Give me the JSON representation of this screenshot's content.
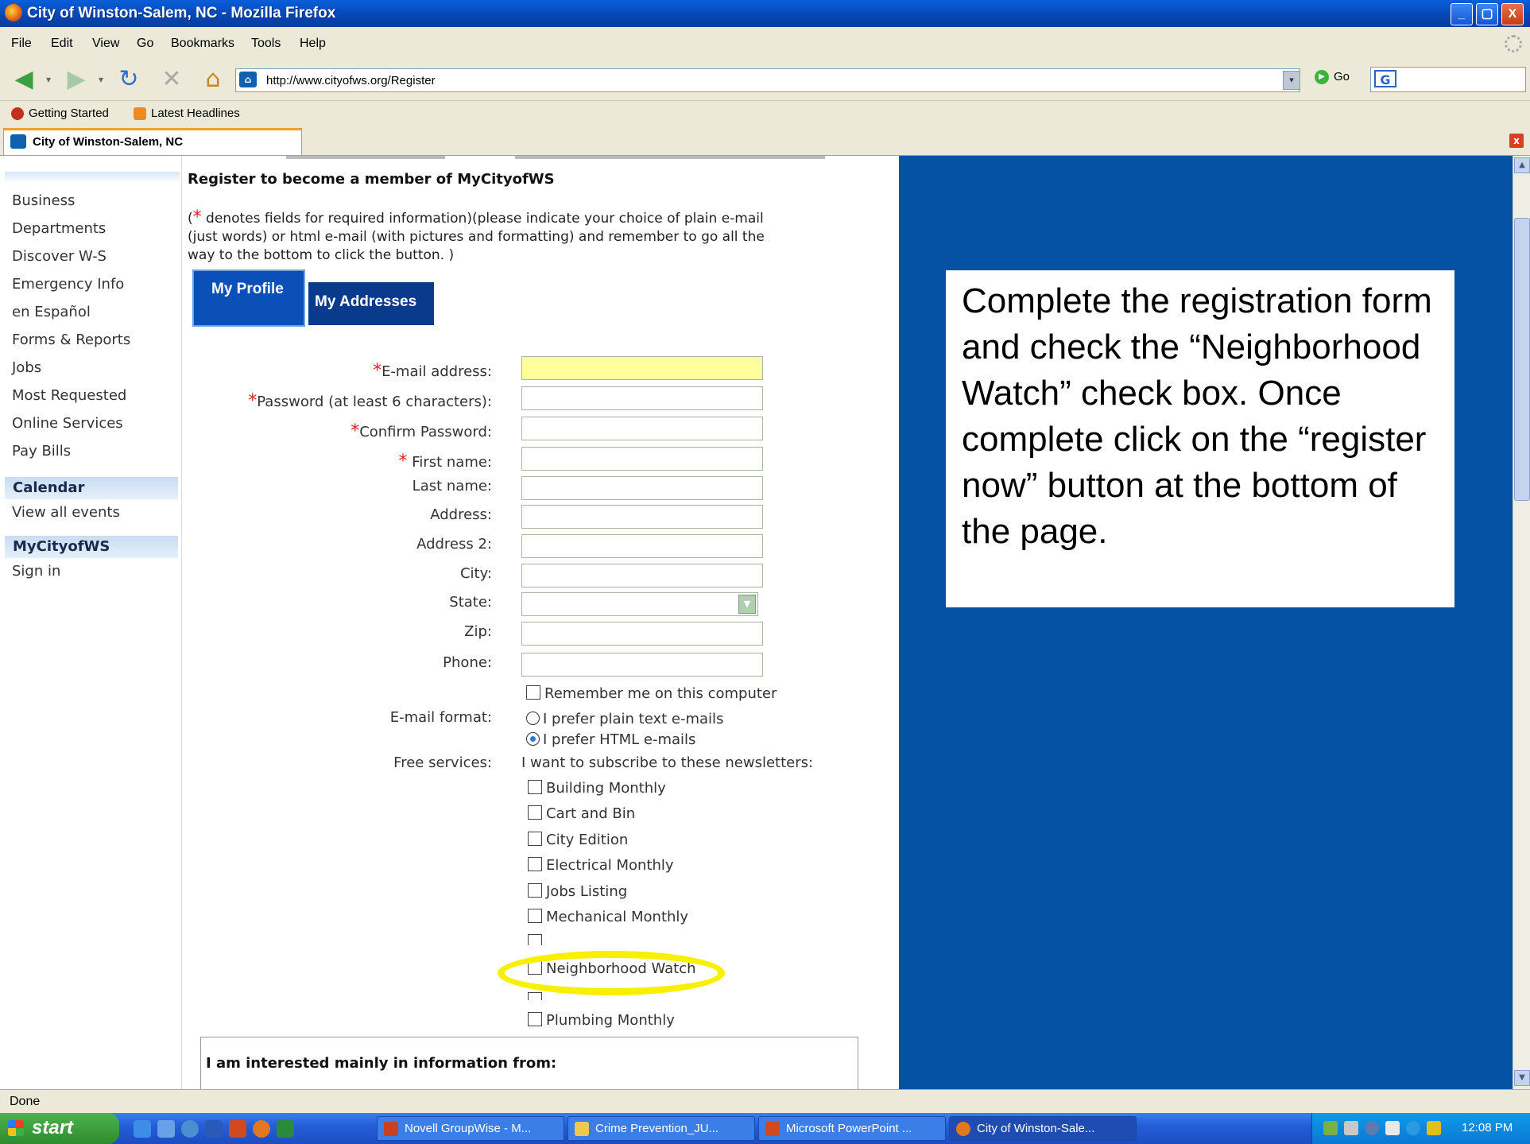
{
  "window": {
    "title": "City of Winston-Salem, NC - Mozilla Firefox",
    "min": "_",
    "max": "▢",
    "close": "X"
  },
  "menu": [
    "File",
    "Edit",
    "View",
    "Go",
    "Bookmarks",
    "Tools",
    "Help"
  ],
  "nav": {
    "back": "◀",
    "forward": "▶",
    "dropdown": "▾",
    "reload": "↻",
    "stop": "✕",
    "home": "⌂",
    "url": "http://www.cityofws.org/Register",
    "go_label": "Go"
  },
  "bookmarks": [
    "Getting Started",
    "Latest Headlines"
  ],
  "tab": {
    "title": "City of Winston-Salem, NC",
    "close": "x"
  },
  "sidebar": {
    "links": [
      "Business",
      "Departments",
      "Discover W-S",
      "Emergency Info",
      "en Español",
      "Forms & Reports",
      "Jobs",
      "Most Requested",
      "Online Services",
      "Pay Bills"
    ],
    "calendar_heading": "Calendar",
    "calendar_link": "View all events",
    "mycity_heading": "MyCityofWS",
    "mycity_link": "Sign in"
  },
  "form": {
    "title": "Register to become a member of MyCityofWS",
    "note_star": "*",
    "note": " denotes fields for required information)(please indicate your choice of plain e-mail (just words) or html e-mail (with pictures and formatting) and remember to go all the way to the bottom to click the button. )",
    "note_open": "(",
    "tabs": {
      "profile": "My Profile",
      "addresses": "My Addresses"
    },
    "fields": [
      {
        "label": "E-mail address:",
        "required": true,
        "value": ""
      },
      {
        "label": "Password (at least 6 characters):",
        "required": true,
        "value": ""
      },
      {
        "label": "Confirm Password:",
        "required": true,
        "value": ""
      },
      {
        "label": "First name:",
        "required": true,
        "value": ""
      },
      {
        "label": "Last name:",
        "required": false,
        "value": ""
      },
      {
        "label": "Address:",
        "required": false,
        "value": ""
      },
      {
        "label": "Address 2:",
        "required": false,
        "value": ""
      },
      {
        "label": "City:",
        "required": false,
        "value": ""
      }
    ],
    "state_label": "State:",
    "state_value": "",
    "zip_label": "Zip:",
    "phone_label": "Phone:",
    "remember": "Remember me on this computer",
    "email_format_label": "E-mail format:",
    "plain_text": "I prefer plain text e-mails",
    "html_text": "I prefer HTML e-mails",
    "selected_format": "html",
    "free_services_label": "Free services:",
    "newsletters_intro": "I want to subscribe to these newsletters:",
    "newsletters": [
      "Building Monthly",
      "Cart and Bin",
      "City Edition",
      "Electrical Monthly",
      "Jobs Listing",
      "Mechanical Monthly",
      "Neighborhood Watch",
      "Plumbing Monthly"
    ],
    "interest_heading": "I am interested mainly in information from:"
  },
  "callout": {
    "text": "Complete the registration form and check the “Neighborhood Watch” check box.  Once complete click on the “register now” button at the bottom of the page."
  },
  "status": "Done",
  "taskbar": {
    "start": "start",
    "tasks": [
      "Novell GroupWise - M...",
      "Crime Prevention_JU...",
      "Microsoft PowerPoint ...",
      "City of Winston-Sale..."
    ],
    "clock": "12:08 PM"
  },
  "colors": {
    "accent_blue": "#0552a5",
    "highlight": "#f8f000",
    "required": "#e02020"
  }
}
